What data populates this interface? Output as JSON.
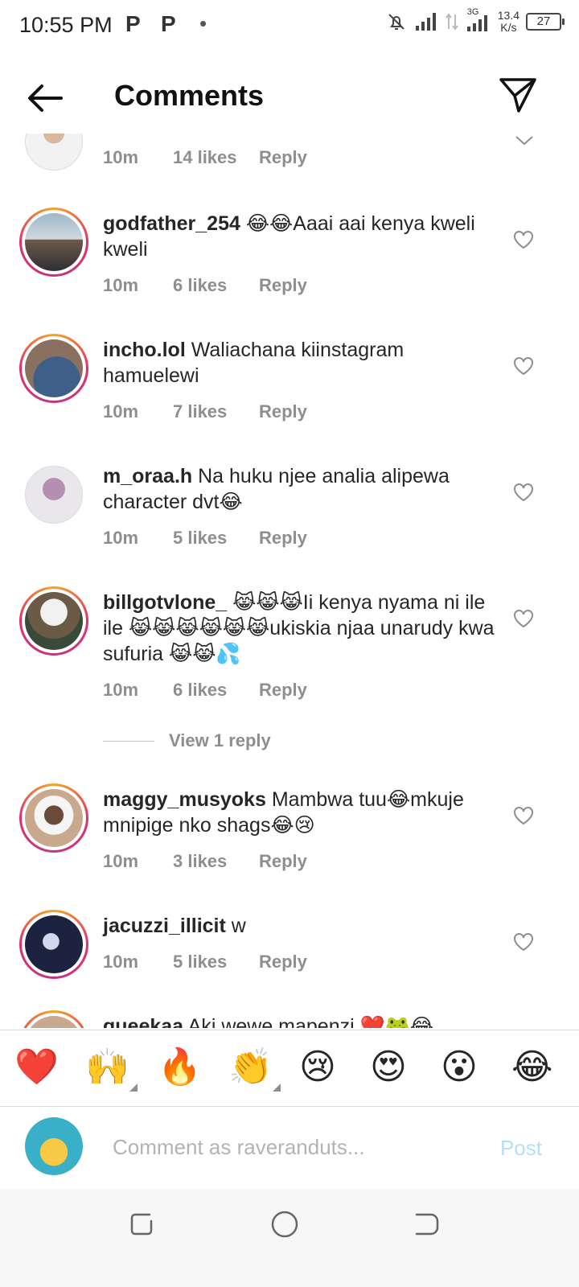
{
  "status_bar": {
    "time": "10:55 PM",
    "notif_icons": [
      "P",
      "P",
      "•"
    ],
    "network": "3G",
    "speed_value": "13.4",
    "speed_unit": "K/s",
    "battery": "27"
  },
  "header": {
    "title": "Comments"
  },
  "comments": [
    {
      "username": "",
      "text": "",
      "time": "10m",
      "likes": "14 likes",
      "reply": "Reply"
    },
    {
      "username": "godfather_254",
      "text": "😂😂Aaai aai kenya kweli kweli",
      "time": "10m",
      "likes": "6 likes",
      "reply": "Reply"
    },
    {
      "username": "incho.lol",
      "text": "Waliachana kiinstagram hamuelewi",
      "time": "10m",
      "likes": "7 likes",
      "reply": "Reply"
    },
    {
      "username": "m_oraa.h",
      "text": "Na huku njee analia alipewa character dvt😂",
      "time": "10m",
      "likes": "5 likes",
      "reply": "Reply"
    },
    {
      "username": "billgotvlone_",
      "text": "😹😹😹Ii kenya nyama ni ile ile 😹😹😹😹😹😹ukiskia njaa unarudy kwa sufuria 😹😹💦",
      "time": "10m",
      "likes": "6 likes",
      "reply": "Reply"
    },
    {
      "username": "maggy_musyoks",
      "text": "Mambwa tuu😂mkuje mnipige nko shags😂😢",
      "time": "10m",
      "likes": "3 likes",
      "reply": "Reply"
    },
    {
      "username": "jacuzzi_illicit",
      "text": "w",
      "time": "10m",
      "likes": "5 likes",
      "reply": "Reply"
    },
    {
      "username": "queekaa",
      "text": "Aki wewe mapenzi ❤️🐸😂",
      "time": "",
      "likes": "",
      "reply": ""
    }
  ],
  "view_replies": "View 1 reply",
  "emoji_bar": [
    "❤️",
    "🙌",
    "🔥",
    "👏",
    "😢",
    "😍",
    "😮",
    "😂"
  ],
  "comment_input": {
    "placeholder": "Comment as raveranduts...",
    "post_label": "Post"
  },
  "colors": {
    "text": "#262626",
    "meta": "#8e8e8e",
    "post_disabled": "#b2dffc",
    "story_ring": "#e1306c"
  }
}
